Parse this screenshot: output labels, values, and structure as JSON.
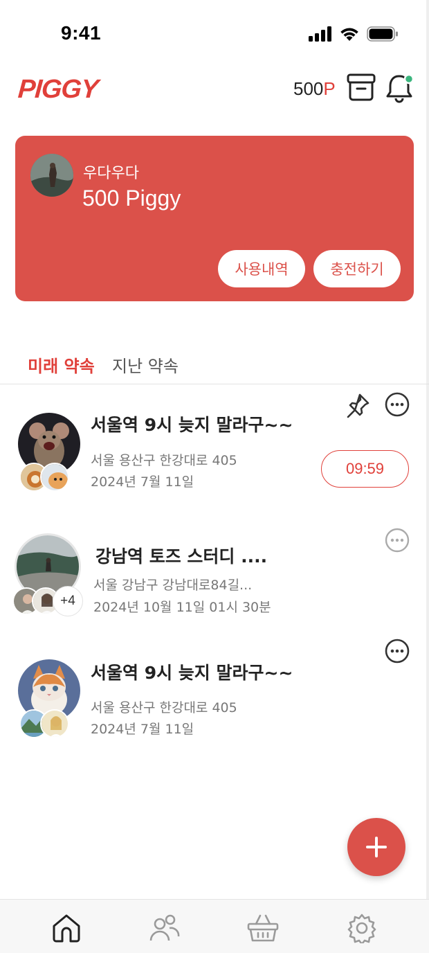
{
  "status_bar": {
    "time": "9:41"
  },
  "header": {
    "logo": "PIGGY",
    "points_value": "500",
    "points_unit": "P"
  },
  "wallet": {
    "user_name": "우다우다",
    "balance": "500 Piggy",
    "history_label": "사용내역",
    "charge_label": "충전하기"
  },
  "tabs": {
    "future": "미래 약속",
    "past": "지난 약속"
  },
  "appointments": [
    {
      "title": "서울역 9시 늦지 말라구~~",
      "address": "서울 용산구 한강대로 405",
      "date": "2024년 7월 11일",
      "timer": "09:59",
      "pinned": true
    },
    {
      "title": "강남역 토즈 스터디 ....",
      "address": "서울 강남구 강남대로84길...",
      "date": "2024년 10월 11일 01시 30분",
      "extra_members": "+4"
    },
    {
      "title": "서울역 9시 늦지 말라구~~",
      "address": "서울 용산구 한강대로 405",
      "date": "2024년 7월 11일"
    }
  ],
  "colors": {
    "brand": "#db514a",
    "accent_text": "#e0403a"
  },
  "icons": [
    "signal-icon",
    "wifi-icon",
    "battery-icon",
    "archive-icon",
    "bell-icon",
    "pin-icon",
    "more-icon",
    "plus-icon",
    "home-icon",
    "friends-icon",
    "basket-icon",
    "settings-icon"
  ]
}
